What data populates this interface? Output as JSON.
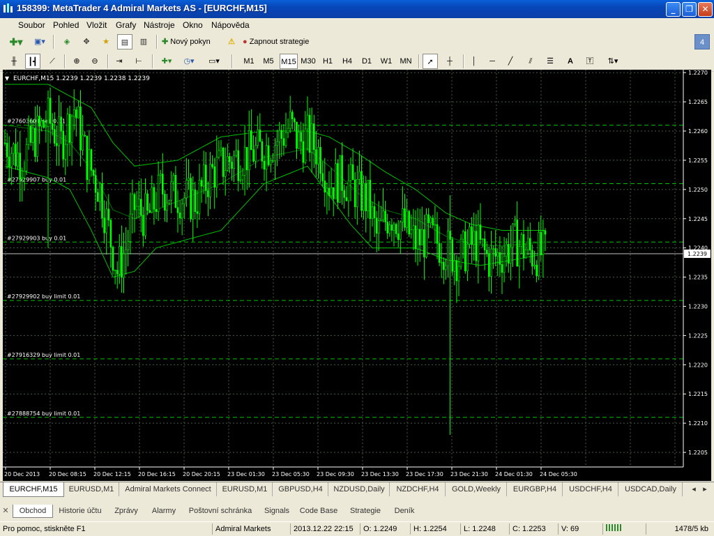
{
  "window": {
    "title": "158399: MetaTrader 4 Admiral Markets AS - [EURCHF,M15]",
    "minimize": "_",
    "restore": "❐",
    "close": "✕"
  },
  "menu": [
    "Soubor",
    "Pohled",
    "Vložit",
    "Grafy",
    "Nástroje",
    "Okno",
    "Nápověda"
  ],
  "toolbar": {
    "new_order": "Nový pokyn",
    "autotrading": "Zapnout strategie",
    "badge": "4",
    "timeframes": [
      "M1",
      "M5",
      "M15",
      "M30",
      "H1",
      "H4",
      "D1",
      "W1",
      "MN"
    ],
    "active_timeframe": "M15"
  },
  "chart": {
    "header": "EURCHF,M15  1.2239 1.2239 1.2238 1.2239",
    "current_price_label": "1.2239",
    "colors": {
      "background": "#000000",
      "candles": "#00ff00",
      "grid": "#4a5a4a",
      "levels": "#00c000",
      "bands": "#00c000",
      "axis_text": "#ffffff"
    },
    "price_ticks": [
      "1.2270",
      "1.2265",
      "1.2260",
      "1.2255",
      "1.2250",
      "1.2245",
      "1.2240",
      "1.2235",
      "1.2230",
      "1.2225",
      "1.2220",
      "1.2215",
      "1.2210",
      "1.2205"
    ],
    "time_ticks": [
      "20 Dec 2013",
      "20 Dec 08:15",
      "20 Dec 12:15",
      "20 Dec 16:15",
      "20 Dec 20:15",
      "23 Dec 01:30",
      "23 Dec 05:30",
      "23 Dec 09:30",
      "23 Dec 13:30",
      "23 Dec 17:30",
      "23 Dec 21:30",
      "24 Dec 01:30",
      "24 Dec 05:30"
    ],
    "order_lines": [
      {
        "label": "#27603601 sell 0.01",
        "price": 1.2261
      },
      {
        "label": "#27929907 buy 0.01",
        "price": 1.2251
      },
      {
        "label": "#27929903 buy 0.01",
        "price": 1.2241
      },
      {
        "label": "#27929902 buy limit 0.01",
        "price": 1.2231
      },
      {
        "label": "#27916329 buy limit 0.01",
        "price": 1.2221
      },
      {
        "label": "#27888754 buy limit 0.01",
        "price": 1.2211
      }
    ]
  },
  "chart_data": {
    "type": "candlestick",
    "symbol": "EURCHF",
    "timeframe": "M15",
    "ylim": [
      1.22025,
      1.22705
    ],
    "close_path": [
      [
        0,
        1.2258
      ],
      [
        8,
        1.2255
      ],
      [
        14,
        1.2259
      ],
      [
        20,
        1.2262
      ],
      [
        26,
        1.2258
      ],
      [
        32,
        1.2264
      ],
      [
        38,
        1.2255
      ],
      [
        44,
        1.225
      ],
      [
        48,
        1.2243
      ],
      [
        52,
        1.2236
      ],
      [
        56,
        1.224
      ],
      [
        60,
        1.2247
      ],
      [
        66,
        1.2245
      ],
      [
        72,
        1.225
      ],
      [
        80,
        1.2249
      ],
      [
        88,
        1.2248
      ],
      [
        96,
        1.2253
      ],
      [
        104,
        1.2255
      ],
      [
        112,
        1.2256
      ],
      [
        120,
        1.2257
      ],
      [
        128,
        1.2259
      ],
      [
        132,
        1.2261
      ],
      [
        136,
        1.2258
      ],
      [
        140,
        1.2259
      ],
      [
        146,
        1.2256
      ],
      [
        150,
        1.2251
      ],
      [
        156,
        1.2252
      ],
      [
        162,
        1.225
      ],
      [
        168,
        1.2248
      ],
      [
        172,
        1.2242
      ],
      [
        178,
        1.2246
      ],
      [
        184,
        1.2244
      ],
      [
        190,
        1.2241
      ],
      [
        196,
        1.2242
      ],
      [
        204,
        1.224
      ],
      [
        210,
        1.2238
      ],
      [
        214,
        1.224
      ],
      [
        218,
        1.2241
      ],
      [
        224,
        1.2238
      ],
      [
        230,
        1.2239
      ],
      [
        236,
        1.2241
      ],
      [
        240,
        1.224
      ],
      [
        244,
        1.2239
      ],
      [
        250,
        1.2239
      ]
    ],
    "spikes": [
      {
        "index": 20,
        "low": 1.224
      },
      {
        "index": 52,
        "low": 1.2233
      },
      {
        "index": 206,
        "high": 1.2249,
        "low": 1.2208
      }
    ],
    "bollinger_upper": [
      [
        0,
        1.2268
      ],
      [
        20,
        1.2268
      ],
      [
        30,
        1.2266
      ],
      [
        40,
        1.2264
      ],
      [
        50,
        1.2258
      ],
      [
        60,
        1.2254
      ],
      [
        80,
        1.2255
      ],
      [
        100,
        1.2259
      ],
      [
        120,
        1.226
      ],
      [
        140,
        1.226
      ],
      [
        150,
        1.2259
      ],
      [
        164,
        1.2256
      ],
      [
        176,
        1.2253
      ],
      [
        190,
        1.225
      ],
      [
        204,
        1.2246
      ],
      [
        216,
        1.2244
      ],
      [
        230,
        1.2243
      ],
      [
        250,
        1.2243
      ]
    ],
    "bollinger_lower": [
      [
        0,
        1.2254
      ],
      [
        10,
        1.2253
      ],
      [
        20,
        1.2252
      ],
      [
        30,
        1.225
      ],
      [
        40,
        1.2243
      ],
      [
        50,
        1.2235
      ],
      [
        60,
        1.2236
      ],
      [
        70,
        1.224
      ],
      [
        80,
        1.2241
      ],
      [
        100,
        1.2243
      ],
      [
        120,
        1.2251
      ],
      [
        140,
        1.2254
      ],
      [
        150,
        1.2249
      ],
      [
        160,
        1.2244
      ],
      [
        170,
        1.224
      ],
      [
        190,
        1.224
      ],
      [
        204,
        1.2238
      ],
      [
        220,
        1.2237
      ],
      [
        236,
        1.2238
      ],
      [
        250,
        1.2239
      ]
    ]
  },
  "tabs": [
    "EURCHF,M15",
    "EURUSD,M1",
    "Admiral Markets Connect",
    "EURUSD,M1",
    "GBPUSD,H4",
    "NZDUSD,Daily",
    "NZDCHF,H4",
    "GOLD,Weekly",
    "EURGBP,H4",
    "USDCHF,H4",
    "USDCAD,Daily"
  ],
  "subtabs": [
    "Obchod",
    "Historie účtu",
    "Zprávy",
    "Alarmy",
    "Poštovní schránka",
    "Signals",
    "Code Base",
    "Strategie",
    "Deník"
  ],
  "status": {
    "help": "Pro pomoc, stiskněte F1",
    "broker": "Admiral Markets",
    "datetime": "2013.12.22 22:15",
    "open": "O: 1.2249",
    "high": "H: 1.2254",
    "low": "L: 1.2248",
    "close": "C: 1.2253",
    "volume": "V: 69",
    "traffic": "1478/5 kb"
  }
}
